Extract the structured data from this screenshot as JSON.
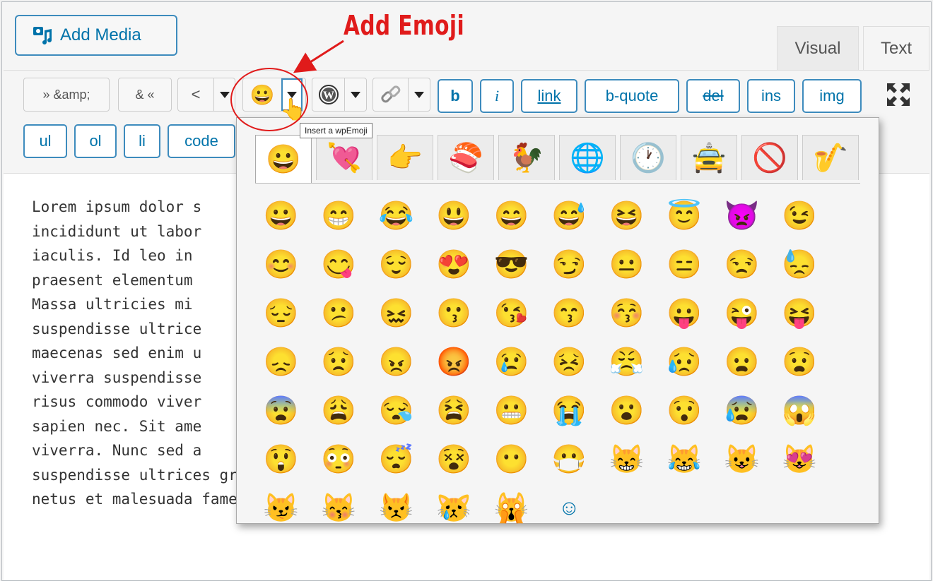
{
  "annotation": "Add Emoji",
  "add_media": "Add Media",
  "tabs": {
    "visual": "Visual",
    "text": "Text"
  },
  "toolbar": {
    "raquo_amp": "» &amp;",
    "amp_laquo": "& «",
    "lt": "<",
    "b": "b",
    "i": "i",
    "link": "link",
    "bquote": "b-quote",
    "del": "del",
    "ins": "ins",
    "img": "img",
    "ul": "ul",
    "ol": "ol",
    "li": "li",
    "code": "code"
  },
  "tooltip": "Insert a wpEmoji",
  "content_lines": [
    "Lorem ipsum dolor s                                                        or",
    "incididunt ut labor                                                        s",
    "iaculis. Id leo in                                                         m",
    "praesent elementum                                                         .",
    "Massa ultricies mi                                                         um",
    "suspendisse ultrice",
    "maecenas sed enim u                                                        um",
    "viverra suspendisse",
    "risus commodo viver",
    "sapien nec. Sit ame",
    "viverra. Nunc sed a",
    "suspendisse ultrices gravida. Vitae nunc sed velit dignissim sodales ut. Et",
    "netus et malesuada fames ac turpis egestas. Enim neque volutpat ac tincidunt"
  ],
  "emoji_categories": [
    "😀",
    "💘",
    "👉",
    "🍣",
    "🐓",
    "🌐",
    "🕐",
    "🚖",
    "🚫",
    "🎷"
  ],
  "emoji_grid": [
    "😀",
    "😁",
    "😂",
    "😃",
    "😄",
    "😅",
    "😆",
    "😇",
    "👿",
    "😉",
    "😊",
    "😋",
    "😌",
    "😍",
    "😎",
    "😏",
    "😐",
    "😑",
    "😒",
    "😓",
    "😔",
    "😕",
    "😖",
    "😗",
    "😘",
    "😙",
    "😚",
    "😛",
    "😜",
    "😝",
    "😞",
    "😟",
    "😠",
    "😡",
    "😢",
    "😣",
    "😤",
    "😥",
    "😦",
    "😧",
    "😨",
    "😩",
    "😪",
    "😫",
    "😬",
    "😭",
    "😮",
    "😯",
    "😰",
    "😱",
    "😲",
    "😳",
    "😴",
    "😵",
    "😶",
    "😷",
    "😸",
    "😹",
    "😺",
    "😻",
    "😼",
    "😽",
    "😾",
    "😿",
    "🙀",
    "☺"
  ],
  "colors": {
    "accent": "#0073aa",
    "annotation": "#e01b1b"
  }
}
